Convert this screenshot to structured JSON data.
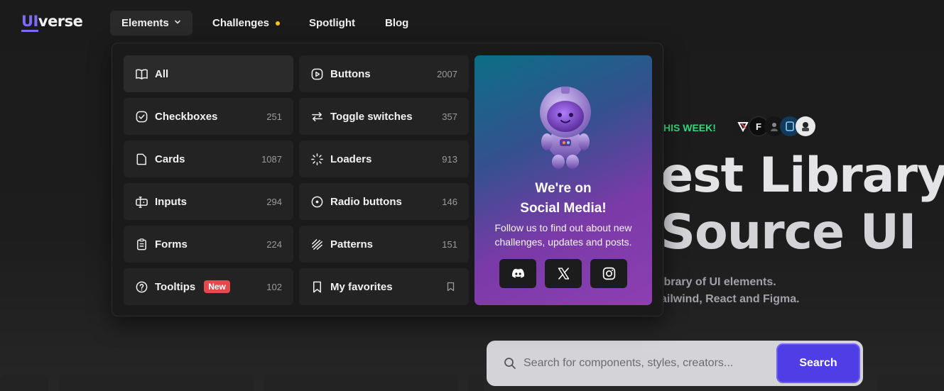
{
  "brand": {
    "logo_ui": "UI",
    "logo_verse": "verse"
  },
  "nav": {
    "elements": "Elements",
    "challenges": "Challenges",
    "spotlight": "Spotlight",
    "blog": "Blog"
  },
  "hero": {
    "week_label": "HIS WEEK!",
    "title_line1": "est Library",
    "title_line2": "Source UI",
    "subtitle_line1": "ibrary of UI elements.",
    "subtitle_line2": "ailwind, React and Figma."
  },
  "dropdown": {
    "items": [
      {
        "label": "All",
        "count": "",
        "icon": "book-icon"
      },
      {
        "label": "Buttons",
        "count": "2007",
        "icon": "play-square-icon"
      },
      {
        "label": "Checkboxes",
        "count": "251",
        "icon": "check-circle-icon"
      },
      {
        "label": "Toggle switches",
        "count": "357",
        "icon": "arrows-swap-icon"
      },
      {
        "label": "Cards",
        "count": "1087",
        "icon": "file-icon"
      },
      {
        "label": "Loaders",
        "count": "913",
        "icon": "loader-icon"
      },
      {
        "label": "Inputs",
        "count": "294",
        "icon": "input-icon"
      },
      {
        "label": "Radio buttons",
        "count": "146",
        "icon": "radio-icon"
      },
      {
        "label": "Forms",
        "count": "224",
        "icon": "clipboard-icon"
      },
      {
        "label": "Patterns",
        "count": "151",
        "icon": "pattern-icon"
      },
      {
        "label": "Tooltips",
        "count": "102",
        "badge": "New",
        "icon": "help-circle-icon"
      },
      {
        "label": "My favorites",
        "count": "",
        "icon": "bookmark-icon"
      }
    ],
    "social": {
      "title_line1": "We're on",
      "title_line2": "Social Media!",
      "text": "Follow us to find out about new challenges, updates and posts."
    }
  },
  "search": {
    "placeholder": "Search for components, styles, creators...",
    "button": "Search"
  },
  "colors": {
    "accent": "#4f3ee6",
    "badge": "#e5484d",
    "week": "#37d67a",
    "challenge_dot": "#f5c518"
  }
}
